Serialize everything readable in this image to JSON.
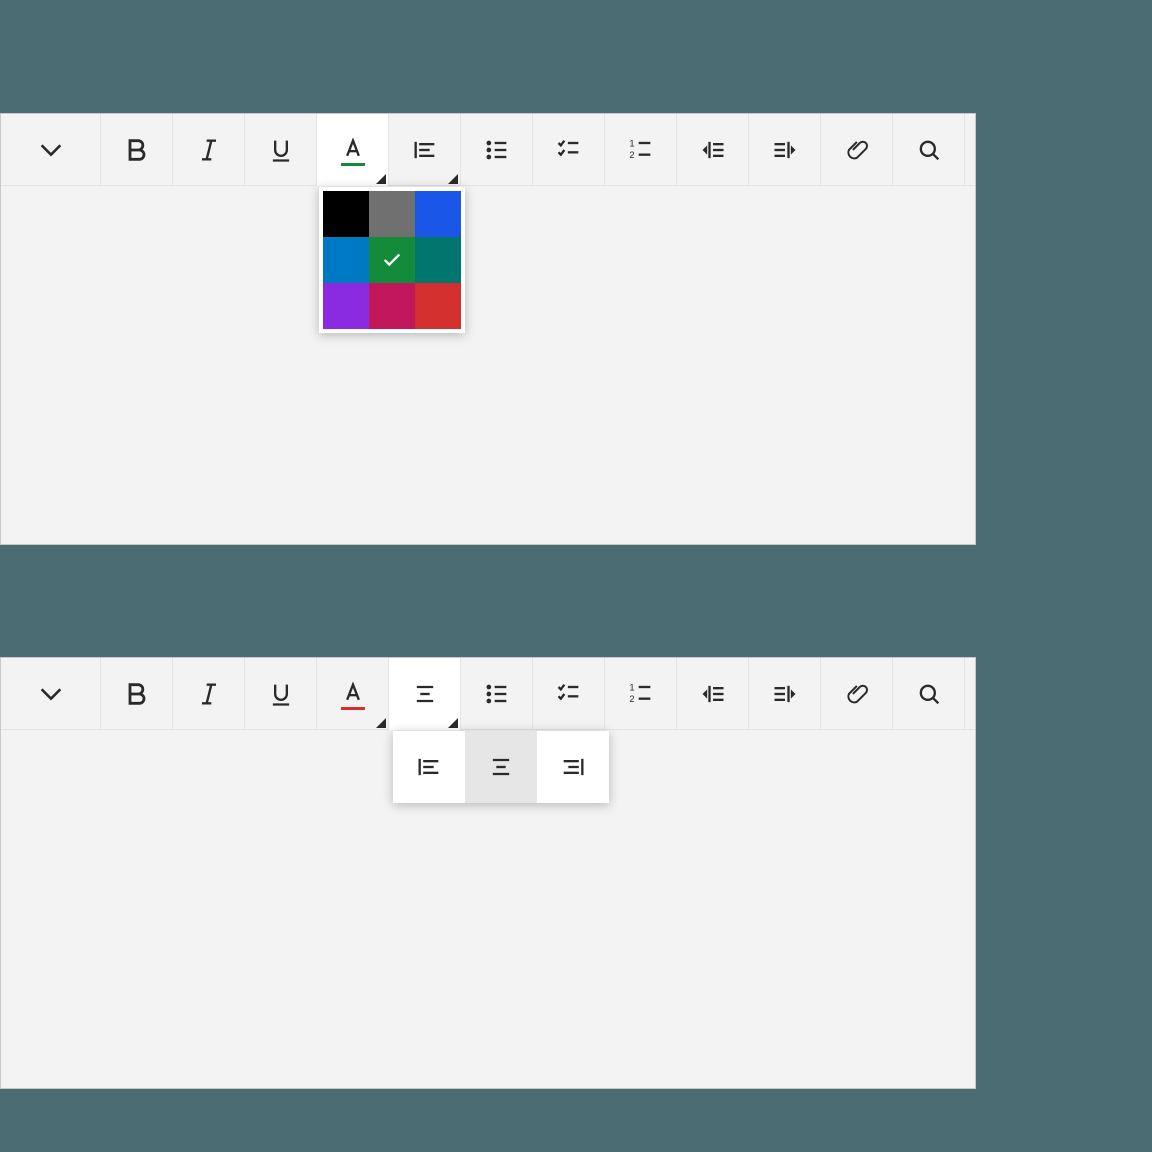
{
  "toolbar": {
    "buttons": [
      {
        "name": "expand",
        "interactable": true
      },
      {
        "name": "bold",
        "interactable": true
      },
      {
        "name": "italic",
        "interactable": true
      },
      {
        "name": "underline",
        "interactable": true
      },
      {
        "name": "text-color",
        "interactable": true,
        "dropdown": true,
        "underline_color": "#148a3b"
      },
      {
        "name": "align",
        "interactable": true,
        "dropdown": true
      },
      {
        "name": "bullet-list",
        "interactable": true
      },
      {
        "name": "check-list",
        "interactable": true
      },
      {
        "name": "numbered-list",
        "interactable": true
      },
      {
        "name": "indent-increase",
        "interactable": true
      },
      {
        "name": "indent-decrease",
        "interactable": true
      },
      {
        "name": "attachment",
        "interactable": true
      },
      {
        "name": "search",
        "interactable": true
      }
    ]
  },
  "color_picker": {
    "selected": "#148a3b",
    "colors": [
      "#000000",
      "#707070",
      "#1a56e8",
      "#0079c4",
      "#148a3b",
      "#00766f",
      "#8a2be2",
      "#c2185b",
      "#d32f2f"
    ]
  },
  "align_picker": {
    "selected": "center",
    "options": [
      "left",
      "center",
      "right"
    ]
  }
}
